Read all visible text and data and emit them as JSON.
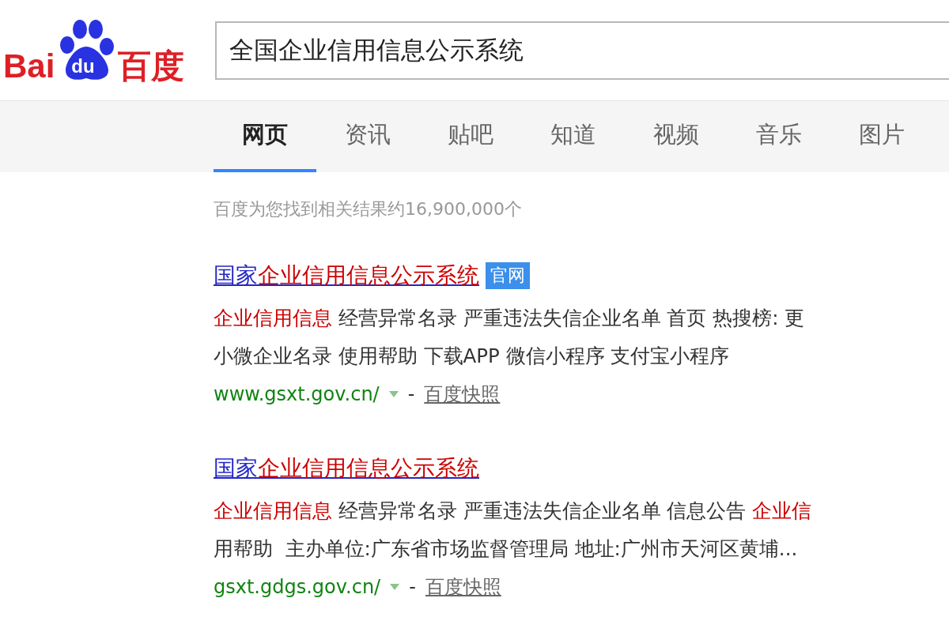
{
  "logo": {
    "left": "Bai",
    "paw": "du",
    "right": "百度"
  },
  "search": {
    "value": "全国企业信用信息公示系统"
  },
  "tabs": [
    {
      "label": "网页",
      "selected": true
    },
    {
      "label": "资讯",
      "selected": false
    },
    {
      "label": "贴吧",
      "selected": false
    },
    {
      "label": "知道",
      "selected": false
    },
    {
      "label": "视频",
      "selected": false
    },
    {
      "label": "音乐",
      "selected": false
    },
    {
      "label": "图片",
      "selected": false
    }
  ],
  "result_count": "百度为您找到相关结果约16,900,000个",
  "results": [
    {
      "title": [
        {
          "text": "国家",
          "hit": false
        },
        {
          "text": "企业信用信息公示系统",
          "hit": true
        }
      ],
      "badge": "官网",
      "snippet": [
        [
          {
            "text": "企业信用信息",
            "hit": true
          },
          {
            "text": " 经营异常名录 严重违法失信企业名单 首页 热搜榜: 更",
            "hit": false
          }
        ],
        [
          {
            "text": "小微企业名录 使用帮助 下载APP 微信小程序 支付宝小程序",
            "hit": false
          }
        ]
      ],
      "url": "www.gsxt.gov.cn/",
      "separator": "-",
      "snapshot": "百度快照"
    },
    {
      "title": [
        {
          "text": "国家",
          "hit": false
        },
        {
          "text": "企业信用信息公示系统",
          "hit": true
        }
      ],
      "snippet": [
        [
          {
            "text": "企业信用信息",
            "hit": true
          },
          {
            "text": " 经营异常名录 严重违法失信企业名单 信息公告 ",
            "hit": false
          },
          {
            "text": "企业信",
            "hit": true
          }
        ],
        [
          {
            "text": "用帮助  主办单位:广东省市场监督管理局 地址:广州市天河区黄埔...",
            "hit": false
          }
        ]
      ],
      "url": "gsxt.gdgs.gov.cn/",
      "separator": "-",
      "snapshot": "百度快照"
    }
  ]
}
